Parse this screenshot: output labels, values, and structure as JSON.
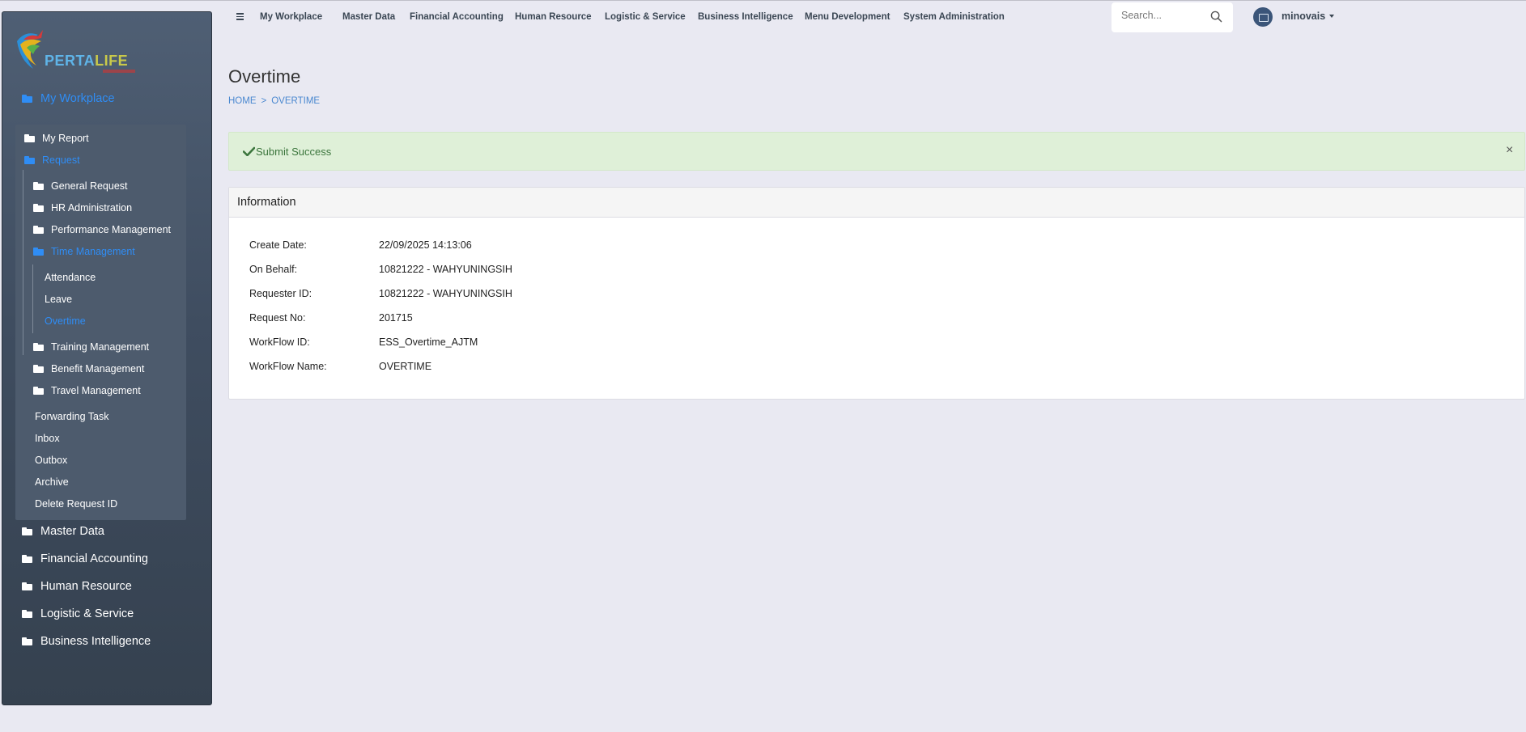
{
  "app": {
    "logo_text_a": "PERTA",
    "logo_text_b": "LIFE"
  },
  "topnav": {
    "items": [
      "My Workplace",
      "Master Data",
      "Financial Accounting",
      "Human Resource",
      "Logistic & Service",
      "Business Intelligence",
      "Menu Development",
      "System Administration"
    ],
    "search_placeholder": "Search...",
    "user": "minovais"
  },
  "sidebar": {
    "my_workplace": "My Workplace",
    "my_report": "My Report",
    "request": "Request",
    "general_request": "General Request",
    "hr_administration": "HR Administration",
    "performance_management": "Performance Management",
    "time_management": "Time Management",
    "attendance": "Attendance",
    "leave": "Leave",
    "overtime": "Overtime",
    "training_management": "Training Management",
    "benefit_management": "Benefit Management",
    "travel_management": "Travel Management",
    "forwarding_task": "Forwarding Task",
    "inbox": "Inbox",
    "outbox": "Outbox",
    "archive": "Archive",
    "delete_request_id": "Delete Request ID",
    "master_data": "Master Data",
    "financial_accounting": "Financial Accounting",
    "human_resource": "Human Resource",
    "logistic_service": "Logistic & Service",
    "business_intelligence": "Business Intelligence"
  },
  "page": {
    "title": "Overtime",
    "breadcrumb_home": "HOME",
    "breadcrumb_sep": ">",
    "breadcrumb_current": "OVERTIME"
  },
  "alert": {
    "message": "Submit Success",
    "close": "×"
  },
  "info": {
    "title": "Information",
    "rows": [
      {
        "label": "Create Date:",
        "value": "22/09/2025 14:13:06"
      },
      {
        "label": "On Behalf:",
        "value": "10821222 - WAHYUNINGSIH"
      },
      {
        "label": "Requester ID:",
        "value": "10821222 - WAHYUNINGSIH"
      },
      {
        "label": "Request No:",
        "value": "201715"
      },
      {
        "label": "WorkFlow ID:",
        "value": "ESS_Overtime_AJTM"
      },
      {
        "label": "WorkFlow Name:",
        "value": "OVERTIME"
      }
    ]
  },
  "colors": {
    "accent": "#2f8df5",
    "sidebar": "#3f4d60",
    "alert_bg": "#dff0d8",
    "alert_text": "#3c763d"
  }
}
